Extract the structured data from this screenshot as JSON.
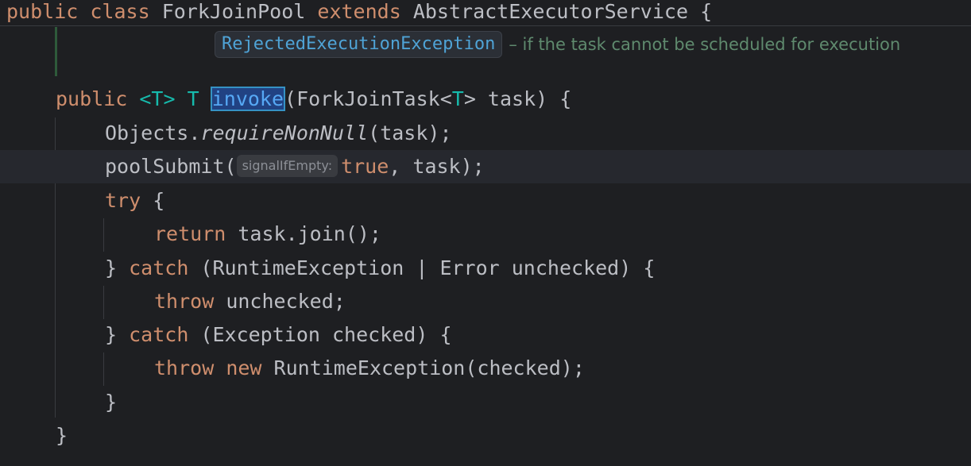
{
  "editor": {
    "language": "Java",
    "sticky_header": {
      "kw_public": "public",
      "kw_class": "class",
      "class_name": "ForkJoinPool",
      "kw_extends": "extends",
      "super_name": "AbstractExecutorService",
      "brace": "{"
    },
    "javadoc": {
      "code": "RejectedExecutionException",
      "text": "– if the task cannot be scheduled for execution"
    },
    "method": {
      "kw_public": "public",
      "type_param": "<T>",
      "return_type": "T",
      "name": "invoke",
      "params_pre": "(ForkJoinTask<",
      "params_t": "T",
      "params_post": "> task) {"
    },
    "line_require": {
      "obj": "Objects.",
      "call": "requireNonNull",
      "args": "(task);"
    },
    "line_submit": {
      "call": "poolSubmit(",
      "hint": "signalIfEmpty:",
      "kw_true": "true",
      "rest": ", task);"
    },
    "line_try": {
      "kw": "try",
      "rest": " {"
    },
    "line_return": {
      "kw": "return",
      "rest": " task.join();"
    },
    "line_catch1": {
      "pre": "} ",
      "kw": "catch",
      "rest": " (RuntimeException | Error unchecked) {"
    },
    "line_throw1": {
      "kw": "throw",
      "rest": " unchecked;"
    },
    "line_catch2": {
      "pre": "} ",
      "kw": "catch",
      "rest": " (Exception checked) {"
    },
    "line_throw2": {
      "kw": "throw",
      "kw2": "new",
      "rest": " RuntimeException(checked);"
    },
    "line_close_try": "}",
    "line_close_method": "}"
  },
  "colors": {
    "background": "#1e1f22",
    "keyword": "#cf8e6d",
    "type_param": "#16baac",
    "method_decl": "#56a8f5",
    "doc_text": "#5f8a6e",
    "current_line": "#26282e"
  }
}
